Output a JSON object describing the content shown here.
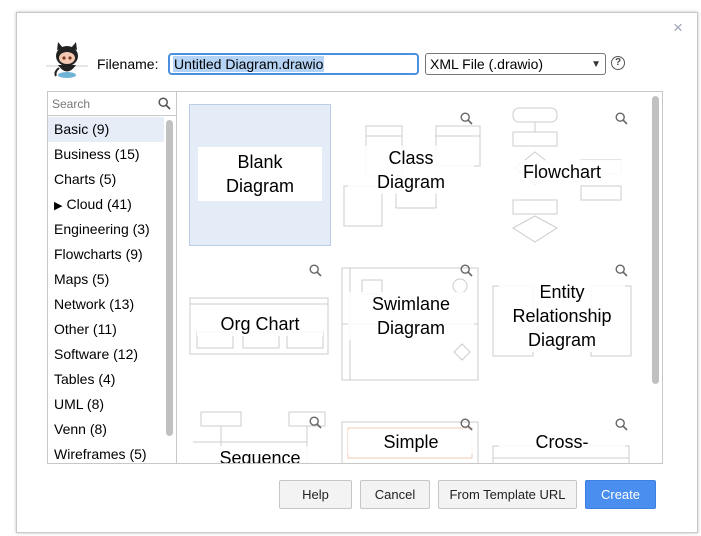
{
  "dialog": {
    "close_icon": "close-icon"
  },
  "header": {
    "filename_label": "Filename:",
    "filename_value": "Untitled Diagram.drawio",
    "format_value": "XML File (.drawio)",
    "help_label": "?"
  },
  "search": {
    "placeholder": "Search"
  },
  "categories": [
    {
      "label": "Basic (9)",
      "selected": true
    },
    {
      "label": "Business (15)"
    },
    {
      "label": "Charts (5)"
    },
    {
      "label": "Cloud (41)",
      "expandable": true
    },
    {
      "label": "Engineering (3)"
    },
    {
      "label": "Flowcharts (9)"
    },
    {
      "label": "Maps (5)"
    },
    {
      "label": "Network (13)"
    },
    {
      "label": "Other (11)"
    },
    {
      "label": "Software (12)"
    },
    {
      "label": "Tables (4)"
    },
    {
      "label": "UML (8)"
    },
    {
      "label": "Venn (8)"
    },
    {
      "label": "Wireframes (5)"
    }
  ],
  "templates": [
    {
      "line1": "Blank",
      "line2": "Diagram"
    },
    {
      "line1": "Class",
      "line2": "Diagram"
    },
    {
      "line1": "Flowchart"
    },
    {
      "line1": "Org Chart"
    },
    {
      "line1": "Swimlane",
      "line2": "Diagram"
    },
    {
      "line1": "Entity",
      "line2": "Relationship",
      "line3": "Diagram"
    },
    {
      "line1": "Sequence"
    },
    {
      "line1": "Simple"
    },
    {
      "line1": "Cross-"
    }
  ],
  "buttons": {
    "help": "Help",
    "cancel": "Cancel",
    "template_url": "From Template URL",
    "create": "Create"
  },
  "colors": {
    "accent": "#4a8ef0",
    "selection": "#e3ecf7"
  }
}
